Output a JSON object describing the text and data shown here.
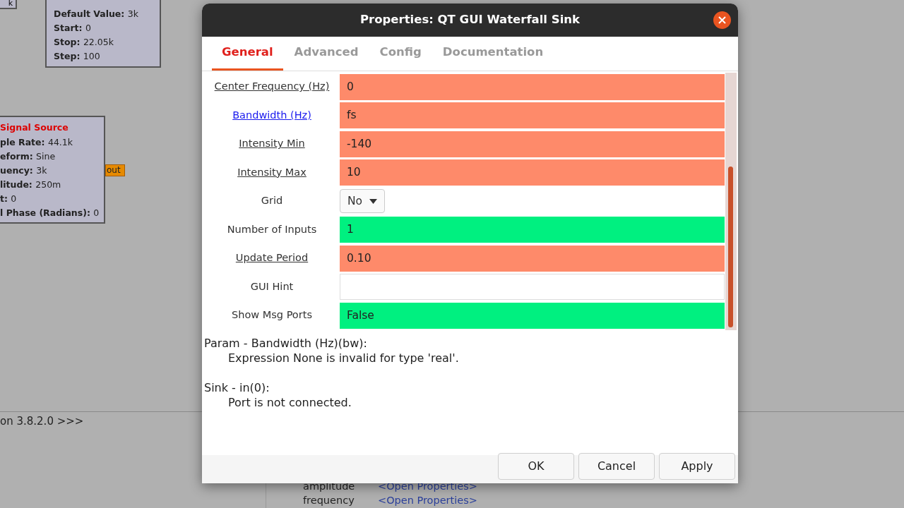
{
  "canvas": {
    "blocks": [
      {
        "kind": "corner",
        "lines": [
          {
            "value": "k"
          }
        ]
      },
      {
        "kind": "variable",
        "lines": [
          {
            "key": "Default Value:",
            "value": "3k"
          },
          {
            "key": "Start:",
            "value": "0"
          },
          {
            "key": "Stop:",
            "value": "22.05k"
          },
          {
            "key": "Step:",
            "value": "100"
          }
        ]
      },
      {
        "kind": "source",
        "title": "Signal Source",
        "port": "out",
        "lines": [
          {
            "key": "ple Rate:",
            "value": "44.1k"
          },
          {
            "key": "eform:",
            "value": "Sine"
          },
          {
            "key": "uency:",
            "value": "3k"
          },
          {
            "key": "litude:",
            "value": "250m"
          },
          {
            "key": "t:",
            "value": "0"
          },
          {
            "key": "l Phase (Radians):",
            "value": "0"
          }
        ]
      }
    ],
    "console": "on 3.8.2.0 >>>",
    "variables": [
      {
        "name": "amplitude",
        "link": "<Open Properties>"
      },
      {
        "name": "frequency",
        "link": "<Open Properties>"
      }
    ]
  },
  "dialog": {
    "title": "Properties: QT GUI Waterfall Sink",
    "tabs": [
      {
        "label": "General",
        "selected": true
      },
      {
        "label": "Advanced",
        "selected": false
      },
      {
        "label": "Config",
        "selected": false
      },
      {
        "label": "Documentation",
        "selected": false
      }
    ],
    "params": [
      {
        "label": "Center Frequency (Hz)",
        "value": "0",
        "kind": "field",
        "color": "#fe8a6a",
        "underlined": true,
        "link": false
      },
      {
        "label": "Bandwidth (Hz)",
        "value": "fs",
        "kind": "field",
        "color": "#fe8a6a",
        "underlined": true,
        "link": true
      },
      {
        "label": "Intensity Min",
        "value": "-140",
        "kind": "field",
        "color": "#fe8a6a",
        "underlined": true,
        "link": false
      },
      {
        "label": "Intensity Max",
        "value": "10",
        "kind": "field",
        "color": "#fe8a6a",
        "underlined": true,
        "link": false
      },
      {
        "label": "Grid",
        "value": "No",
        "kind": "dropdown",
        "underlined": false,
        "link": false
      },
      {
        "label": "Number of Inputs",
        "value": "1",
        "kind": "field",
        "color": "#00f080",
        "underlined": false,
        "link": false
      },
      {
        "label": "Update Period",
        "value": "0.10",
        "kind": "field",
        "color": "#fe8a6a",
        "underlined": true,
        "link": false
      },
      {
        "label": "GUI Hint",
        "kind": "field",
        "color": "#ffffff",
        "underlined": false,
        "link": false
      },
      {
        "label": "Show Msg Ports",
        "value": "False",
        "kind": "field",
        "color": "#00f080",
        "underlined": false,
        "link": false
      }
    ],
    "messages": [
      {
        "title": "Param - Bandwidth (Hz)(bw):",
        "text": "Expression None is invalid for type 'real'."
      },
      {
        "title": "Sink - in(0):",
        "text": "Port is not connected."
      }
    ],
    "buttons": [
      "OK",
      "Cancel",
      "Apply"
    ]
  }
}
